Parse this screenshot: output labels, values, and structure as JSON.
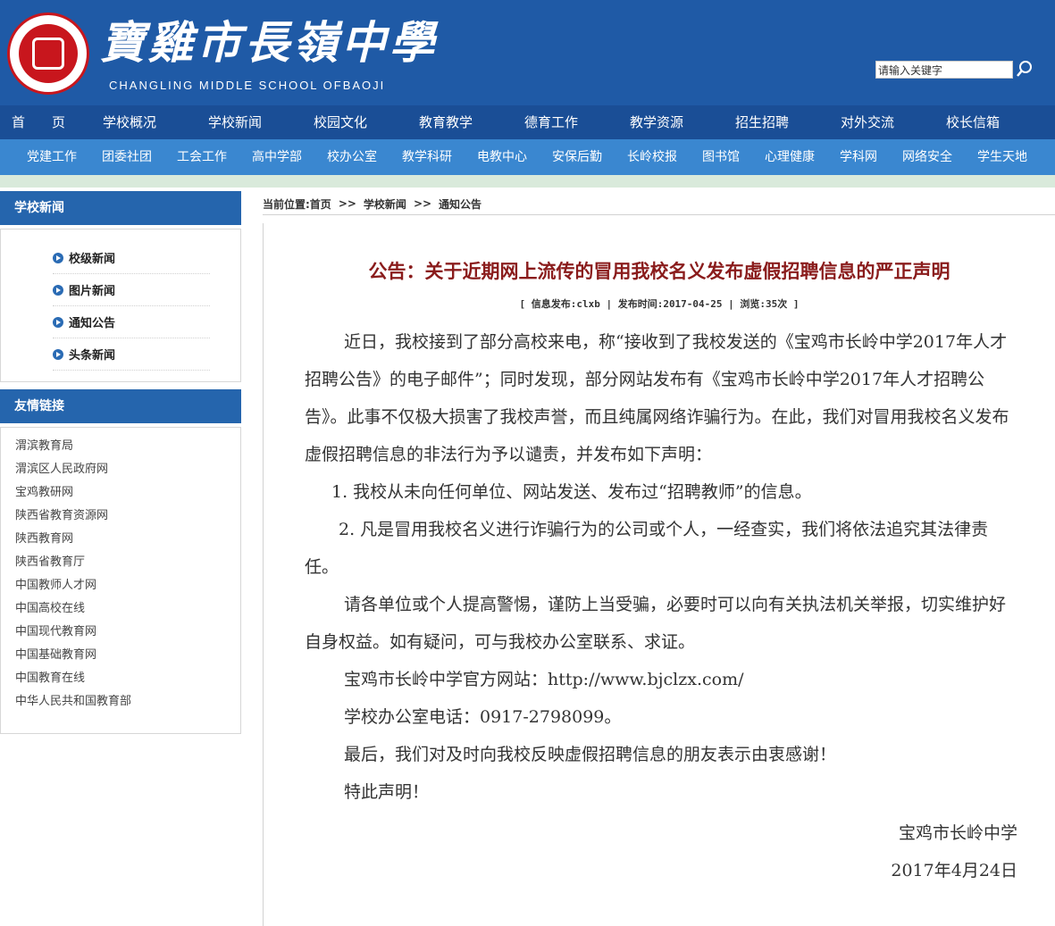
{
  "header": {
    "school_name": "寶雞市長嶺中學",
    "school_name_en": "CHANGLING MIDDLE  SCHOOL  OFBAOJI",
    "search_placeholder": "请输入关键字",
    "brand_color": "#1f5aa6"
  },
  "main_nav": [
    "首　　页",
    "学校概况",
    "学校新闻",
    "校园文化",
    "教育教学",
    "德育工作",
    "教学资源",
    "招生招聘",
    "对外交流",
    "校长信箱"
  ],
  "sub_nav": [
    "党建工作",
    "团委社团",
    "工会工作",
    "高中学部",
    "校办公室",
    "教学科研",
    "电教中心",
    "安保后勤",
    "长岭校报",
    "图书馆",
    "心理健康",
    "学科网",
    "网络安全",
    "学生天地"
  ],
  "sidebar": {
    "news_title": "学校新闻",
    "news_items": [
      "校级新闻",
      "图片新闻",
      "通知公告",
      "头条新闻"
    ],
    "links_title": "友情链接",
    "links": [
      "渭滨教育局",
      "渭滨区人民政府网",
      "宝鸡教研网",
      "陕西省教育资源网",
      "陕西教育网",
      "陕西省教育厅",
      "中国教师人才网",
      "中国高校在线",
      "中国现代教育网",
      "中国基础教育网",
      "中国教育在线",
      "中华人民共和国教育部"
    ]
  },
  "breadcrumb": {
    "prefix": "当前位置:首页",
    "sep": ">>",
    "level1": "学校新闻",
    "level2": "通知公告"
  },
  "article": {
    "title": "公告：关于近期网上流传的冒用我校名义发布虚假招聘信息的严正声明",
    "meta": "[ 信息发布:clxb | 发布时间:2017-04-25 | 浏览:35次 ]",
    "p1": "近日，我校接到了部分高校来电，称“接收到了我校发送的《宝鸡市长岭中学2017年人才招聘公告》的电子邮件”；同时发现，部分网站发布有《宝鸡市长岭中学2017年人才招聘公告》。此事不仅极大损害了我校声誉，而且纯属网络诈骗行为。在此，我们对冒用我校名义发布虚假招聘信息的非法行为予以谴责，并发布如下声明：",
    "p2": "1. 我校从未向任何单位、网站发送、发布过“招聘教师”的信息。",
    "p3": "2. 凡是冒用我校名义进行诈骗行为的公司或个人，一经查实，我们将依法追究其法律责任。",
    "p4": "请各单位或个人提高警惕，谨防上当受骗，必要时可以向有关执法机关举报，切实维护好自身权益。如有疑问，可与我校办公室联系、求证。",
    "p5": "宝鸡市长岭中学官方网站：http://www.bjclzx.com/",
    "p6": "学校办公室电话：0917-2798099。",
    "p7": "最后，我们对及时向我校反映虚假招聘信息的朋友表示由衷感谢！",
    "p8": "特此声明！",
    "sign_org": "宝鸡市长岭中学",
    "sign_date": "2017年4月24日"
  }
}
